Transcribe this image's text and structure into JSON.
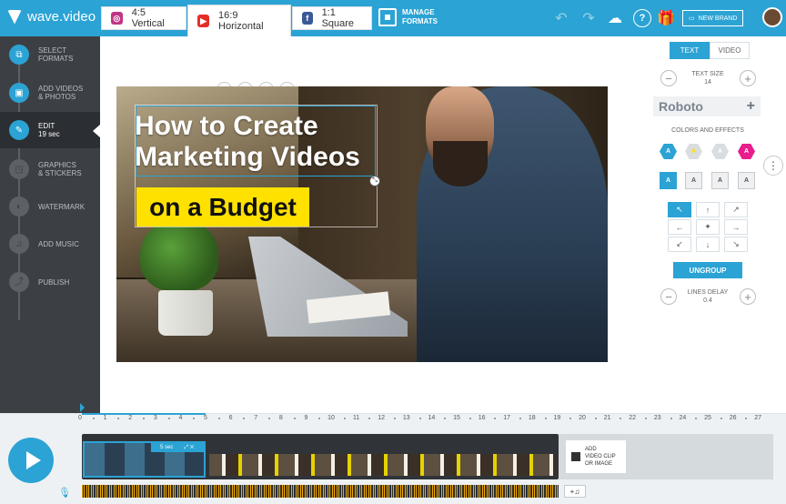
{
  "app": {
    "logo": "wave.video"
  },
  "formats": [
    {
      "label": "4:5 Vertical",
      "icon": "instagram-icon",
      "color": "#c13584"
    },
    {
      "label": "16:9 Horizontal",
      "icon": "youtube-icon",
      "color": "#e52d27"
    },
    {
      "label": "1:1 Square",
      "icon": "facebook-icon",
      "color": "#3b5998"
    }
  ],
  "manage_formats": [
    "MANAGE",
    "FORMATS"
  ],
  "topbar": {
    "new_brand": "NEW BRAND",
    "help_glyph": "?"
  },
  "sidebar": [
    {
      "line1": "SELECT",
      "line2": "FORMATS",
      "icon": "formats-icon",
      "glyph": "⧉"
    },
    {
      "line1": "ADD VIDEOS",
      "line2": "& PHOTOS",
      "icon": "media-icon",
      "glyph": "▣"
    },
    {
      "line1": "EDIT",
      "line2": "19 sec",
      "icon": "edit-icon",
      "glyph": "✎"
    },
    {
      "line1": "GRAPHICS",
      "line2": "& STICKERS",
      "icon": "stickers-icon",
      "glyph": "◳"
    },
    {
      "line1": "WATERMARK",
      "line2": "",
      "icon": "watermark-icon",
      "glyph": "◐"
    },
    {
      "line1": "ADD MUSIC",
      "line2": "",
      "icon": "music-icon",
      "glyph": "♫"
    },
    {
      "line1": "PUBLISH",
      "line2": "",
      "icon": "share-icon",
      "glyph": "⤴"
    }
  ],
  "canvas": {
    "title_line1": "How to Create",
    "title_line2": "Marketing Videos",
    "subtitle": "on a Budget"
  },
  "text_tools": [
    "T+",
    "T↕",
    "A",
    "🗑"
  ],
  "right_panel": {
    "tab_text": "TEXT",
    "tab_video": "VIDEO",
    "text_size_label": "TEXT SIZE",
    "text_size_value": "14",
    "font": "Roboto",
    "colors_label": "COLORS AND EFFECTS",
    "swatches": [
      {
        "color": "#2ba3d4",
        "label": "A"
      },
      {
        "color": "#d9dde0",
        "label": "A"
      },
      {
        "color": "#d9dde0",
        "label": "A"
      },
      {
        "color": "#e91e8c",
        "label": "A"
      }
    ],
    "effects": [
      "A",
      "A",
      "A",
      "A"
    ],
    "grid": [
      "↖",
      "↑",
      "↗",
      "←",
      "✦",
      "→",
      "↙",
      "↓",
      "↘"
    ],
    "ungroup": "UNGROUP",
    "lines_delay_label": "LINES DELAY",
    "lines_delay_value": "0.4",
    "minus": "−",
    "plus": "+"
  },
  "timeline": {
    "ruler": [
      "0",
      "1",
      "2",
      "3",
      "4",
      "5",
      "6",
      "7",
      "8",
      "9",
      "10",
      "11",
      "12",
      "13",
      "14",
      "15",
      "16",
      "17",
      "18",
      "19",
      "20",
      "21",
      "22",
      "23",
      "24",
      "25",
      "26",
      "27"
    ],
    "clip_label": "5 sec",
    "add_clip": [
      "ADD",
      "VIDEO CLIP",
      "OR IMAGE"
    ],
    "audio_glyph": "+♫"
  }
}
